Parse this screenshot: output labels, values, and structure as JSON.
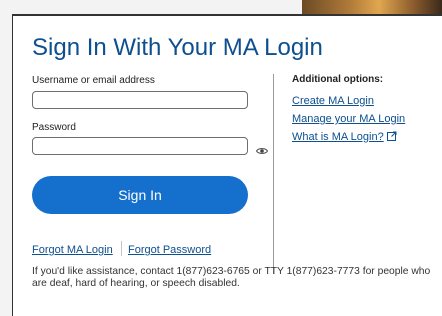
{
  "header": {
    "title": "Sign In With Your MA Login"
  },
  "form": {
    "username_label": "Username or email address",
    "username_value": "",
    "password_label": "Password",
    "password_value": "",
    "sign_in_label": "Sign In"
  },
  "options": {
    "heading": "Additional options:",
    "links": [
      {
        "label": "Create MA Login"
      },
      {
        "label": "Manage your MA Login"
      },
      {
        "label": "What is MA Login?"
      }
    ]
  },
  "footer_links": {
    "forgot_login": "Forgot MA Login",
    "forgot_password": "Forgot Password"
  },
  "assistance": {
    "text": "If you'd like assistance, contact 1(877)623-6765 or TTY 1(877)623-7773 for people who are deaf, hard of hearing, or speech disabled."
  },
  "icons": {
    "password_toggle": "eye-icon",
    "external_link": "external-link-icon"
  },
  "colors": {
    "brand_blue": "#0d4f8f",
    "button_blue": "#1470cc"
  }
}
